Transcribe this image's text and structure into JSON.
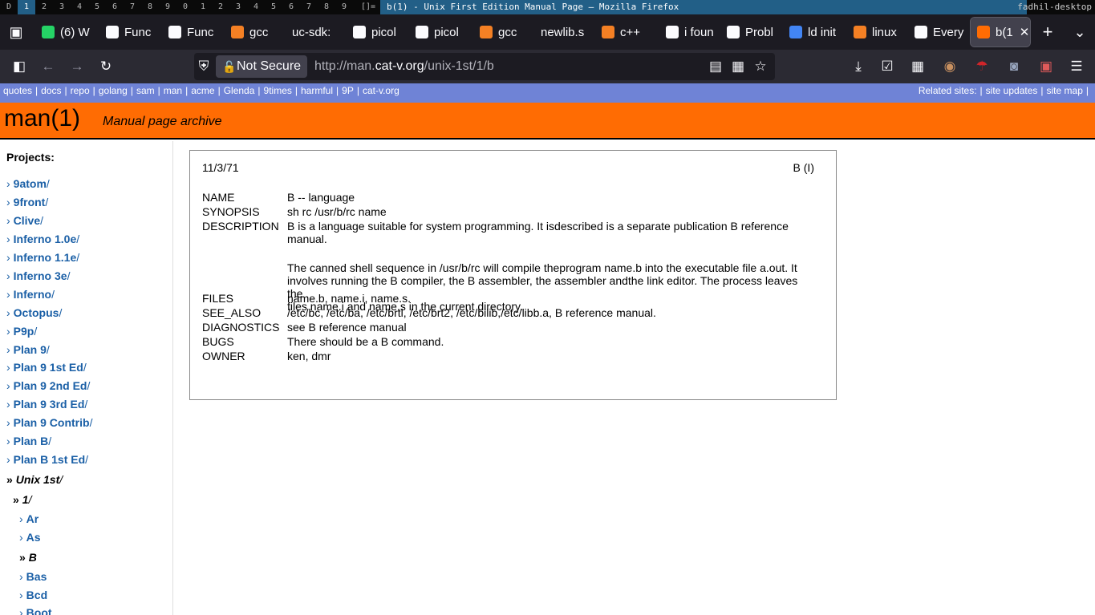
{
  "wm": {
    "workspaces": [
      "1",
      "2",
      "3",
      "4",
      "5",
      "6",
      "7",
      "8",
      "9",
      "0",
      "1",
      "2",
      "3",
      "4",
      "5",
      "6",
      "7",
      "8",
      "9"
    ],
    "prefix": "D",
    "layout": "[]=",
    "title": "b(1) - Unix First Edition Manual Page — Mozilla Firefox",
    "host": "fadhil-desktop"
  },
  "tabs": [
    {
      "label": "(6) W",
      "icon": "whatsapp-icon",
      "color": "#25d366"
    },
    {
      "label": "Func",
      "icon": "chatgpt-icon",
      "color": "#fbfbfe"
    },
    {
      "label": "Func",
      "icon": "chatgpt-icon",
      "color": "#fbfbfe"
    },
    {
      "label": "gcc",
      "icon": "stackoverflow-icon",
      "color": "#f48024"
    },
    {
      "label": "uc-sdk:",
      "icon": "",
      "color": ""
    },
    {
      "label": "picol",
      "icon": "github-icon",
      "color": "#fbfbfe"
    },
    {
      "label": "picol",
      "icon": "github-icon",
      "color": "#fbfbfe"
    },
    {
      "label": "gcc",
      "icon": "stackoverflow-icon",
      "color": "#f48024"
    },
    {
      "label": "newlib.s",
      "icon": "",
      "color": ""
    },
    {
      "label": "c++",
      "icon": "stackoverflow-icon",
      "color": "#f48024"
    },
    {
      "label": "i foun",
      "icon": "bug-icon",
      "color": "#fbfbfe"
    },
    {
      "label": "Probl",
      "icon": "info-icon",
      "color": "#fbfbfe"
    },
    {
      "label": "ld init",
      "icon": "google-icon",
      "color": "#4285f4"
    },
    {
      "label": "linux",
      "icon": "stackoverflow-icon",
      "color": "#f48024"
    },
    {
      "label": "Every",
      "icon": "globe-icon",
      "color": "#fbfbfe"
    },
    {
      "label": "b(1",
      "icon": "cat-v-icon",
      "color": "#ff6c03"
    }
  ],
  "nav": {
    "security_label": "Not Secure",
    "url_prefix": "http://man.",
    "url_domain": "cat-v.org",
    "url_path": "/unix-1st/1/b"
  },
  "sitebar": {
    "links": [
      "quotes",
      "docs",
      "repo",
      "golang",
      "sam",
      "man",
      "acme",
      "Glenda",
      "9times",
      "harmful",
      "9P",
      "cat-v.org"
    ],
    "right_label": "Related sites:",
    "right_links": [
      "site updates",
      "site map"
    ]
  },
  "banner": {
    "title": "man(1)",
    "subtitle": "Manual page archive"
  },
  "sidebar": {
    "heading": "Projects:",
    "items": [
      {
        "label": "9atom",
        "level": 0,
        "current": false
      },
      {
        "label": "9front",
        "level": 0,
        "current": false
      },
      {
        "label": "Clive",
        "level": 0,
        "current": false
      },
      {
        "label": "Inferno 1.0e",
        "level": 0,
        "current": false
      },
      {
        "label": "Inferno 1.1e",
        "level": 0,
        "current": false
      },
      {
        "label": "Inferno 3e",
        "level": 0,
        "current": false
      },
      {
        "label": "Inferno",
        "level": 0,
        "current": false
      },
      {
        "label": "Octopus",
        "level": 0,
        "current": false
      },
      {
        "label": "P9p",
        "level": 0,
        "current": false
      },
      {
        "label": "Plan 9",
        "level": 0,
        "current": false
      },
      {
        "label": "Plan 9 1st Ed",
        "level": 0,
        "current": false
      },
      {
        "label": "Plan 9 2nd Ed",
        "level": 0,
        "current": false
      },
      {
        "label": "Plan 9 3rd Ed",
        "level": 0,
        "current": false
      },
      {
        "label": "Plan 9 Contrib",
        "level": 0,
        "current": false
      },
      {
        "label": "Plan B",
        "level": 0,
        "current": false
      },
      {
        "label": "Plan B 1st Ed",
        "level": 0,
        "current": false
      },
      {
        "label": "Unix 1st",
        "level": 0,
        "current": true
      },
      {
        "label": "1",
        "level": 1,
        "current": true
      },
      {
        "label": "Ar",
        "level": 2,
        "current": false
      },
      {
        "label": "As",
        "level": 2,
        "current": false
      },
      {
        "label": "B",
        "level": 2,
        "current": true
      },
      {
        "label": "Bas",
        "level": 2,
        "current": false
      },
      {
        "label": "Bcd",
        "level": 2,
        "current": false
      },
      {
        "label": "Boot",
        "level": 2,
        "current": false
      }
    ]
  },
  "manpage": {
    "date": "11/3/71",
    "header": "B (I)",
    "sections": [
      {
        "key": "NAME",
        "lines": [
          "B -- language"
        ]
      },
      {
        "key": "SYNOPSIS",
        "lines": [
          "sh rc /usr/b/rc name"
        ]
      },
      {
        "key": "DESCRIPTION",
        "lines": [
          "B is a language suitable for system programming. It isdescribed is a separate publication B reference manual.",
          "",
          "The canned shell sequence in /usr/b/rc will compile theprogram name.b into the executable file a.out. It",
          "involves running the B compiler, the B assembler, the assembler andthe link editor. The process leaves the",
          "files name.i and name.s in the current directory."
        ]
      },
      {
        "key": "FILES",
        "lines": [
          "name.b, name.i, name.s."
        ]
      },
      {
        "key": "SEE_ALSO",
        "lines": [
          "/etc/bc, /etc/ba, /etc/brtl, /etc/brt2, /etc/bilib,/etc/libb.a, B reference manual."
        ]
      },
      {
        "key": "DIAGNOSTICS",
        "lines": [
          "see B reference manual"
        ]
      },
      {
        "key": "BUGS",
        "lines": [
          "There should be a B command."
        ]
      },
      {
        "key": "OWNER",
        "lines": [
          "ken, dmr"
        ]
      }
    ]
  }
}
